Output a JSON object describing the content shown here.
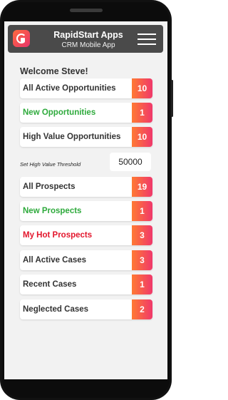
{
  "header": {
    "title": "RapidStart Apps",
    "subtitle": "CRM Mobile App",
    "logo_icon": "rapidstart-logo-icon",
    "menu_icon": "hamburger-menu-icon"
  },
  "welcome": "Welcome Steve!",
  "colors": {
    "green": "#2eaa3c",
    "red": "#e3162c",
    "dark": "#333333"
  },
  "items": [
    {
      "label": "All Active Opportunities",
      "count": "10"
    },
    {
      "label": "New Opportunities",
      "count": "1"
    },
    {
      "label": "High Value Opportunities",
      "count": "10"
    },
    {
      "label": "All Prospects",
      "count": "19"
    },
    {
      "label": "New Prospects",
      "count": "1"
    },
    {
      "label": "My Hot Prospects",
      "count": "3"
    },
    {
      "label": "All Active Cases",
      "count": "3"
    },
    {
      "label": "Recent Cases",
      "count": "1"
    },
    {
      "label": "Neglected Cases",
      "count": "2"
    }
  ],
  "threshold": {
    "label": "Set High Value Threshold",
    "value": "50000"
  }
}
